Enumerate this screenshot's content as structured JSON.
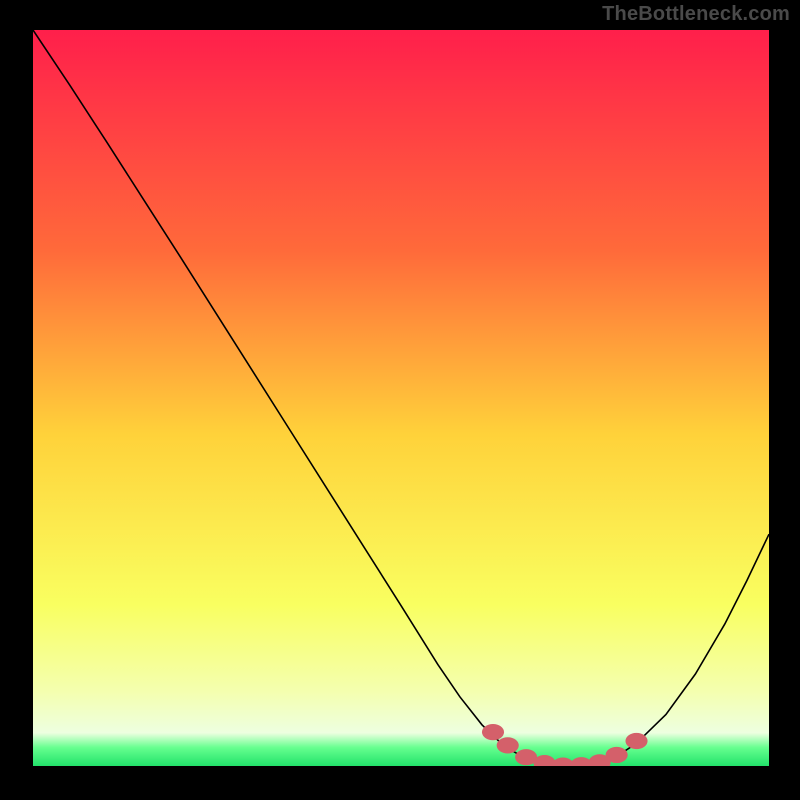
{
  "watermark": "TheBottleneck.com",
  "chart_data": {
    "type": "line",
    "title": "",
    "xlabel": "",
    "ylabel": "",
    "xlim": [
      0,
      100
    ],
    "ylim": [
      0,
      100
    ],
    "background_gradient": {
      "stops": [
        {
          "offset": 0.0,
          "color": "#ff1f4b"
        },
        {
          "offset": 0.3,
          "color": "#ff6a3a"
        },
        {
          "offset": 0.55,
          "color": "#ffd23a"
        },
        {
          "offset": 0.78,
          "color": "#f9ff60"
        },
        {
          "offset": 0.9,
          "color": "#f4ffb0"
        },
        {
          "offset": 0.955,
          "color": "#edffe0"
        },
        {
          "offset": 0.975,
          "color": "#66ff8f"
        },
        {
          "offset": 1.0,
          "color": "#22e26a"
        }
      ]
    },
    "series": [
      {
        "name": "bottleneck-curve",
        "color": "#000000",
        "x": [
          0,
          5,
          10,
          15,
          20,
          25,
          30,
          35,
          40,
          45,
          50,
          55,
          58,
          61,
          64,
          67,
          70,
          73,
          76,
          79,
          82,
          86,
          90,
          94,
          97,
          100
        ],
        "values": [
          100,
          92.5,
          84.8,
          77.0,
          69.2,
          61.3,
          53.4,
          45.5,
          37.6,
          29.7,
          21.8,
          13.8,
          9.4,
          5.6,
          2.7,
          1.0,
          0.2,
          0.0,
          0.2,
          1.1,
          3.1,
          7.0,
          12.5,
          19.3,
          25.2,
          31.5
        ]
      }
    ],
    "dot_cluster": {
      "color": "#d4606a",
      "name": "optimal-range-dots",
      "points": [
        {
          "x": 62.5,
          "y": 4.6
        },
        {
          "x": 64.5,
          "y": 2.8
        },
        {
          "x": 67.0,
          "y": 1.2
        },
        {
          "x": 69.5,
          "y": 0.4
        },
        {
          "x": 72.0,
          "y": 0.05
        },
        {
          "x": 74.5,
          "y": 0.1
        },
        {
          "x": 77.0,
          "y": 0.5
        },
        {
          "x": 79.3,
          "y": 1.5
        },
        {
          "x": 82.0,
          "y": 3.4
        }
      ]
    }
  }
}
